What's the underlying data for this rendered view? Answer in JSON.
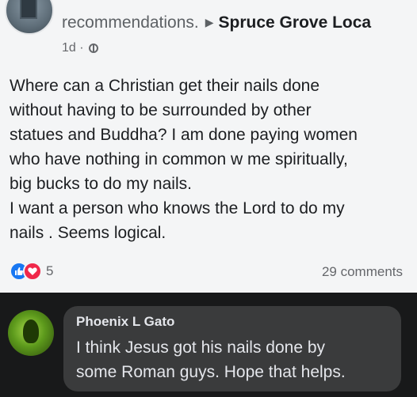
{
  "post": {
    "header_text": "recommendations.",
    "group_name": "Spruce Grove Loca",
    "age": "1d",
    "separator": "·",
    "body_lines": [
      "Where can a Christian get their nails done\nwithout having to be surrounded by other\nstatues and Buddha? I am done paying women\nwho have nothing in common w me  spiritually,\nbig bucks to do my nails.",
      "I want a person who knows the Lord to do my\nnails . Seems logical."
    ],
    "reaction_count": "5",
    "comments_label": "29 comments",
    "reaction_icons": [
      "like-icon",
      "love-icon"
    ]
  },
  "comment": {
    "author": "Phoenix L Gato",
    "text": "I think Jesus got his nails done by\nsome Roman guys. Hope that helps."
  },
  "colors": {
    "post_background": "#f4f5f6",
    "comment_background": "#18191a",
    "bubble": "#3a3b3c",
    "like": "#1877f2",
    "love": "#f0284a"
  }
}
